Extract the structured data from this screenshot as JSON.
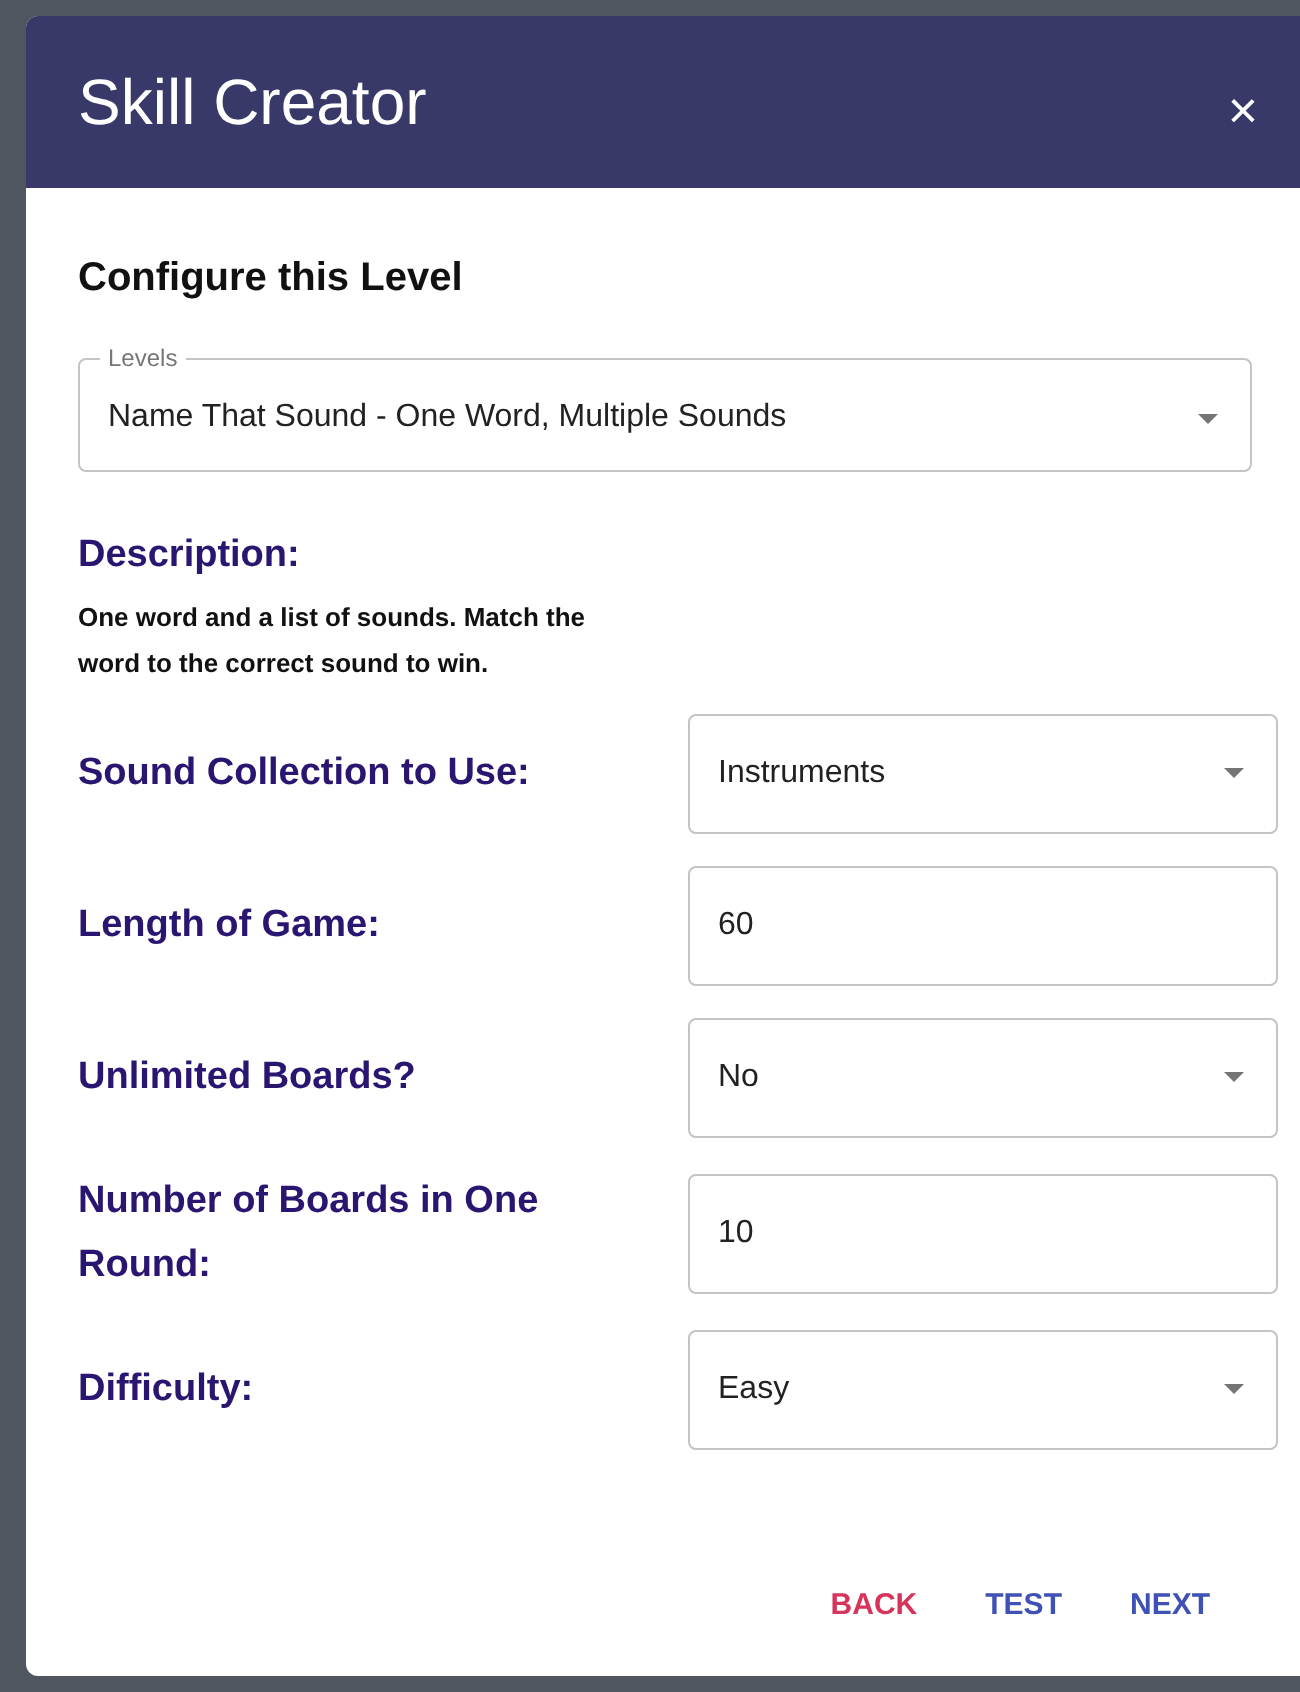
{
  "dialog": {
    "title": "Skill Creator",
    "close": "×"
  },
  "section_title": "Configure this Level",
  "levels_select": {
    "label": "Levels",
    "value": "Name That Sound - One Word, Multiple Sounds"
  },
  "description": {
    "heading": "Description:",
    "text": "One word and a list of sounds. Match the word to the correct sound to win."
  },
  "fields": [
    {
      "label": "Sound Collection to Use:",
      "kind": "select",
      "value": "Instruments"
    },
    {
      "label": "Length of Game:",
      "kind": "text",
      "value": "60"
    },
    {
      "label": "Unlimited Boards?",
      "kind": "select",
      "value": "No"
    },
    {
      "label": "Number of Boards in One Round:",
      "kind": "text",
      "value": "10"
    },
    {
      "label": "Difficulty:",
      "kind": "select",
      "value": "Easy"
    }
  ],
  "buttons": [
    {
      "label": "BACK",
      "kind": "danger"
    },
    {
      "label": "TEST",
      "kind": "primary"
    },
    {
      "label": "NEXT",
      "kind": "primary"
    }
  ]
}
